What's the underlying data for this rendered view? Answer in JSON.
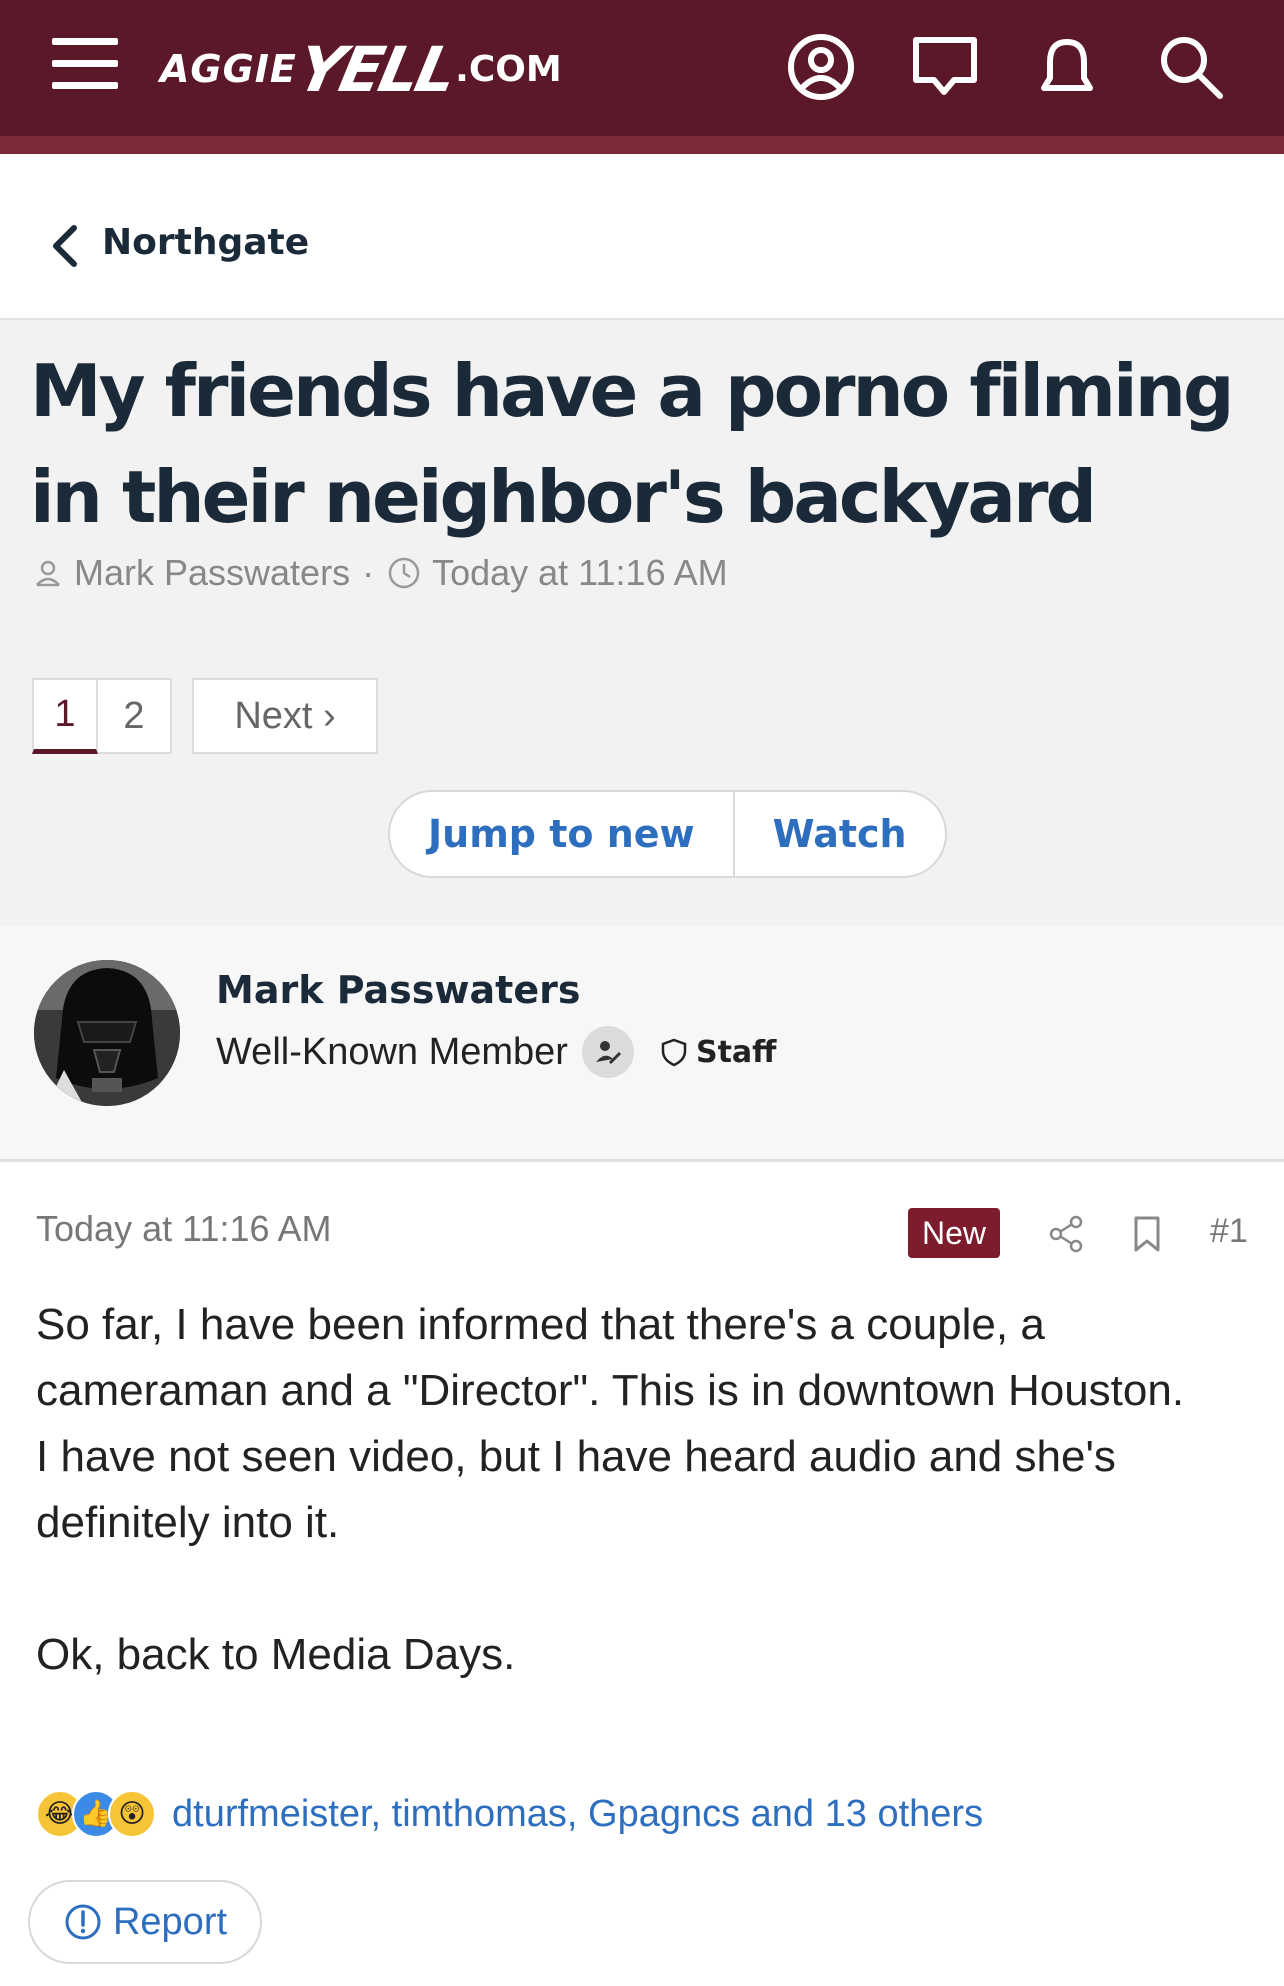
{
  "header": {
    "logo_part1": "AGGIE",
    "logo_part2": "YELL",
    "logo_part3": ".COM",
    "colors": {
      "bar": "#5a1828",
      "accent": "#7d2a3a"
    },
    "icons": [
      "menu-icon",
      "account-icon",
      "conversations-icon",
      "alerts-icon",
      "search-icon"
    ]
  },
  "breadcrumb": {
    "label": "Northgate"
  },
  "thread": {
    "title": "My friends have a porno filming in their neighbor's backyard",
    "author": "Mark Passwaters",
    "separator": "·",
    "time": "Today at 11:16 AM",
    "pages": [
      "1",
      "2"
    ],
    "current_page": "1",
    "next_label": "Next ›",
    "jump_label": "Jump to new",
    "watch_label": "Watch"
  },
  "post": {
    "username": "Mark Passwaters",
    "user_title": "Well-Known Member",
    "staff_label": "Staff",
    "time": "Today at 11:16 AM",
    "new_label": "New",
    "number": "#1",
    "body": "So far, I have been informed that there's a couple, a cameraman and a \"Director\". This is in downtown Houston.\nI have not seen video, but I have heard audio and she's definitely into it.\n\nOk, back to Media Days.",
    "reactions_text": "dturfmeister, timthomas, Gpagncs and 13 others",
    "reaction_icons": [
      "laughing-emoji",
      "like-emoji",
      "wow-emoji"
    ],
    "report_label": "Report"
  }
}
